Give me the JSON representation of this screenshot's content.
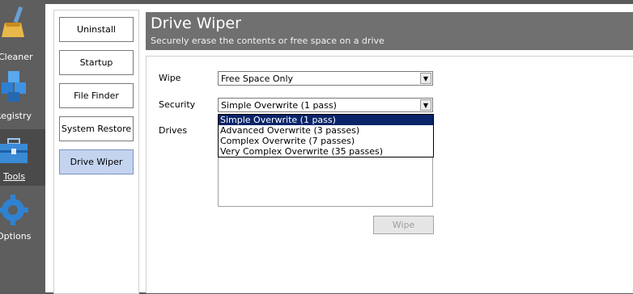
{
  "rail": {
    "items": [
      {
        "label": "Cleaner",
        "icon": "broom-icon"
      },
      {
        "label": "Registry",
        "icon": "registry-cubes-icon"
      },
      {
        "label": "Tools",
        "icon": "toolbox-icon"
      },
      {
        "label": "Options",
        "icon": "gear-icon"
      }
    ]
  },
  "subnav": {
    "items": [
      {
        "label": "Uninstall"
      },
      {
        "label": "Startup"
      },
      {
        "label": "File Finder"
      },
      {
        "label": "System Restore"
      },
      {
        "label": "Drive Wiper"
      }
    ],
    "selected": "Drive Wiper"
  },
  "header": {
    "title": "Drive Wiper",
    "subtitle": "Securely erase the contents or free space on a drive"
  },
  "form": {
    "wipe_label": "Wipe",
    "wipe_value": "Free Space Only",
    "security_label": "Security",
    "security_value": "Simple Overwrite (1 pass)",
    "drives_label": "Drives",
    "security_options": [
      "Simple Overwrite (1 pass)",
      "Advanced Overwrite (3 passes)",
      "Complex Overwrite (7 passes)",
      "Very Complex Overwrite (35 passes)"
    ],
    "wipe_button": "Wipe"
  },
  "colors": {
    "rail_bg": "#5e5e5e",
    "header_bg": "#707070",
    "selected_nav": "#c4d4ef",
    "dropdown_highlight": "#0a246a"
  }
}
